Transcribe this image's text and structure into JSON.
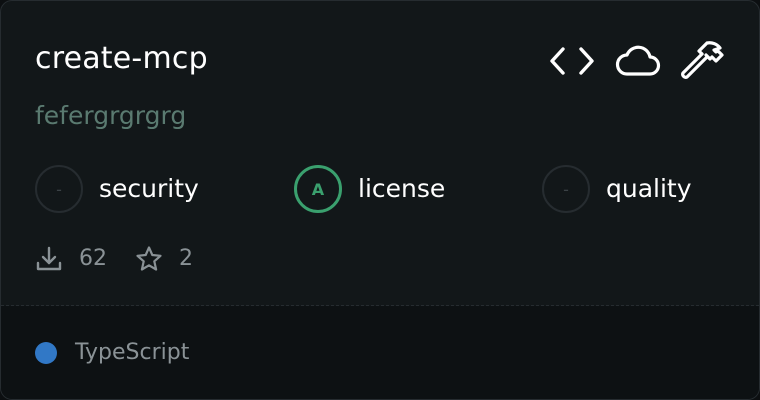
{
  "card": {
    "title": "create-mcp",
    "description": "fefergrgrgrg",
    "top_icons": [
      "code-icon",
      "cloud-icon",
      "hammer-icon"
    ],
    "scores": [
      {
        "grade": "-",
        "label": "security",
        "state": "none"
      },
      {
        "grade": "A",
        "label": "license",
        "state": "a",
        "color": "#3aa06e"
      },
      {
        "grade": "-",
        "label": "quality",
        "state": "none"
      }
    ],
    "stats": {
      "downloads": "62",
      "stars": "2"
    },
    "language": {
      "name": "TypeScript",
      "color": "#3178c6"
    }
  }
}
